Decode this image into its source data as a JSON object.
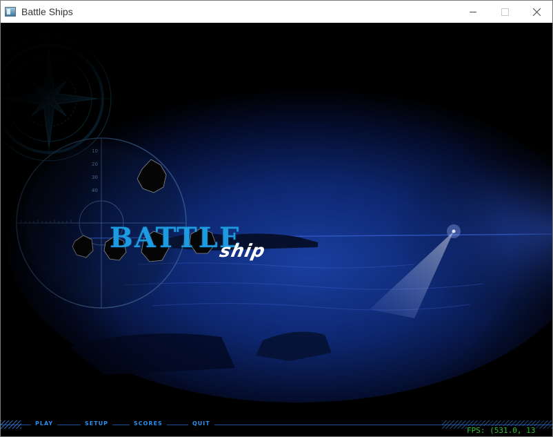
{
  "window": {
    "title": "Battle Ships"
  },
  "logo": {
    "primary": "BATTLE",
    "secondary": "ship"
  },
  "scope": {
    "range_labels": [
      "10",
      "20",
      "30",
      "40"
    ]
  },
  "menu": [
    {
      "label": "PLAY"
    },
    {
      "label": "SETUP"
    },
    {
      "label": "SCORES"
    },
    {
      "label": "QUIT"
    }
  ],
  "status": {
    "fps": "FPS: (531.0, 13"
  },
  "icons": {
    "app": "window-app-icon",
    "minimize": "minimize-icon",
    "maximize": "maximize-icon",
    "close": "close-icon"
  },
  "colors": {
    "accent": "#1e9ae0",
    "menu_text": "#2a8ff0",
    "fps_text": "#2fbf2f",
    "background": "#000000"
  }
}
